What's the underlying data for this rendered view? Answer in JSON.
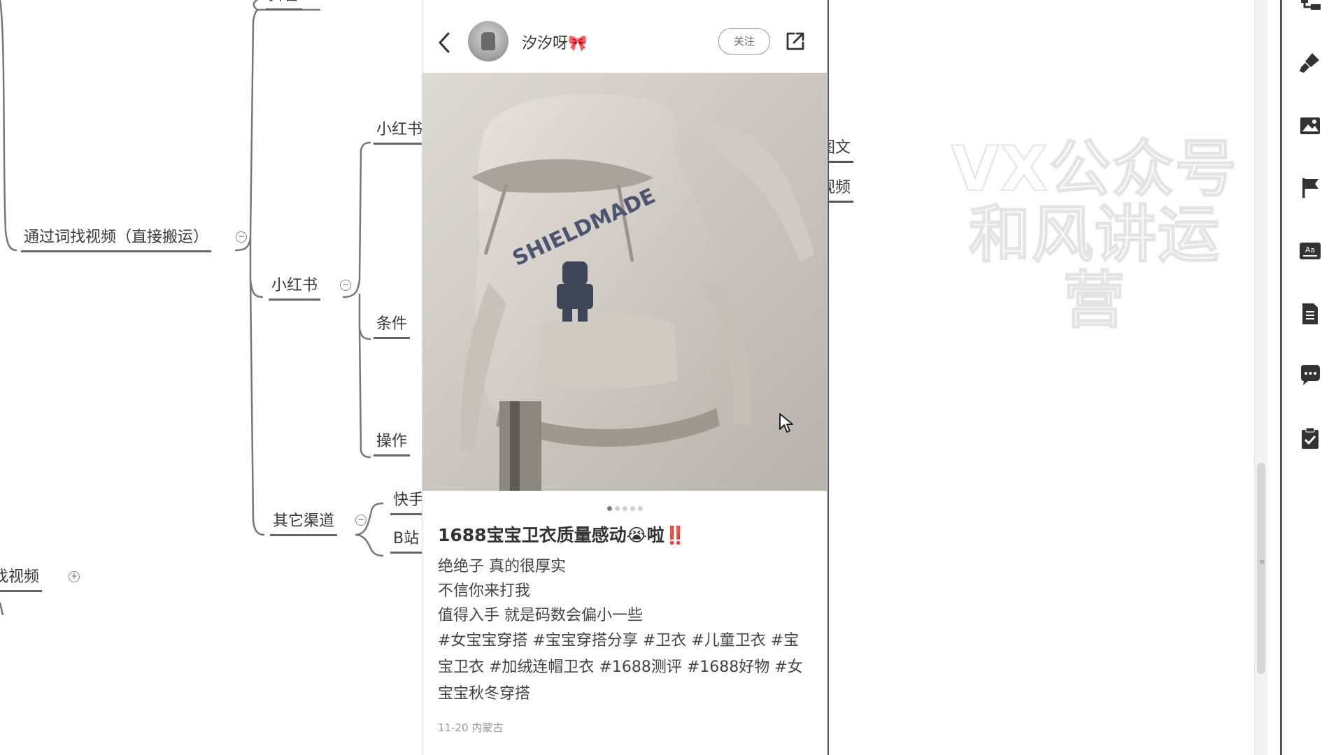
{
  "mindmap": {
    "nodes": {
      "top_fragment": "抖音",
      "find_video": "通过词找视频（直接搬运）",
      "xhs_sub": "小红书",
      "xhs": "小红书",
      "conditions": "条件",
      "operations": "操作",
      "other_channels": "其它渠道",
      "kuaishou": "快手",
      "bilibili": "B站",
      "find_video_bottom": "找视频",
      "tuwen": "图文",
      "shipin": "视频"
    },
    "toggle_collapse": "−",
    "toggle_expand": "+"
  },
  "watermark": {
    "line1": "VX公众号",
    "line2": "和风讲运营"
  },
  "post": {
    "username": "汐汐呀",
    "username_emoji": "🎀",
    "follow_label": "关注",
    "image_count": 5,
    "active_image": 1,
    "title": "1688宝宝卫衣质量感动😭啦‼️",
    "body": [
      "绝绝子 真的很厚实",
      "不信你来打我",
      "值得入手 就是码数会偏小一些"
    ],
    "tags": [
      "#女宝宝穿搭",
      "#宝宝穿搭分享",
      "#卫衣",
      "#儿童卫衣",
      "#宝宝卫衣",
      "#加绒连帽卫衣",
      "#1688测评",
      "#1688好物",
      "#女宝宝秋冬穿搭"
    ],
    "date": "11-20 内蒙古",
    "hoodie_print": "SHIELDMADE"
  },
  "toolbar": {
    "icons": [
      "outline-icon",
      "brush-icon",
      "image-icon",
      "flag-icon",
      "text-style-icon",
      "note-icon",
      "comment-icon",
      "task-icon"
    ]
  },
  "colors": {
    "line": "#666666",
    "node_text": "#3a3a3a",
    "panel_border": "#555555"
  }
}
